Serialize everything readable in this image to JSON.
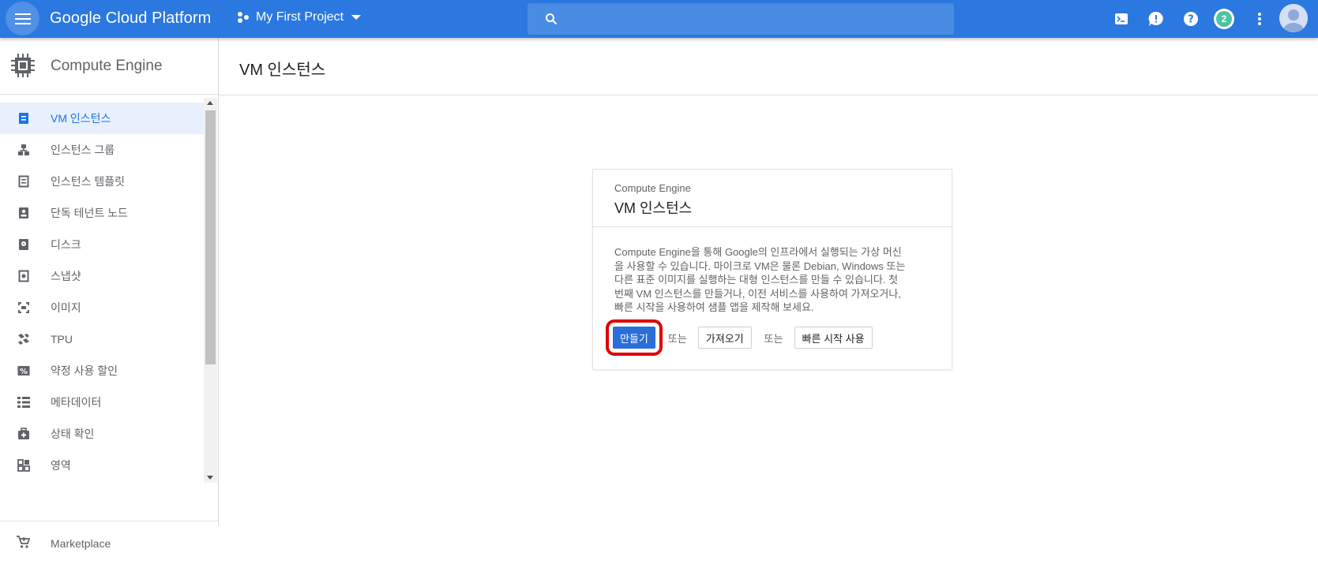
{
  "topbar": {
    "brand": "Google Cloud Platform",
    "project": "My First Project",
    "search_placeholder": "",
    "notification_count": "2",
    "icons": [
      "menu-icon",
      "project-icon",
      "search-icon",
      "cloud-shell-icon",
      "feedback-icon",
      "help-icon",
      "more-vert-icon",
      "account-icon"
    ],
    "color": "#2a78e0"
  },
  "sidebar": {
    "title": "Compute Engine",
    "items": [
      {
        "label": "VM 인스턴스",
        "icon": "vm-instance-icon",
        "active": true
      },
      {
        "label": "인스턴스 그룹",
        "icon": "instance-group-icon"
      },
      {
        "label": "인스턴스 템플릿",
        "icon": "instance-template-icon"
      },
      {
        "label": "단독 테넌트 노드",
        "icon": "sole-tenant-icon"
      },
      {
        "label": "디스크",
        "icon": "disk-icon"
      },
      {
        "label": "스냅샷",
        "icon": "snapshot-icon"
      },
      {
        "label": "이미지",
        "icon": "image-icon"
      },
      {
        "label": "TPU",
        "icon": "tpu-icon"
      },
      {
        "label": "약정 사용 할인",
        "icon": "discount-icon"
      },
      {
        "label": "메타데이터",
        "icon": "metadata-icon"
      },
      {
        "label": "상태 확인",
        "icon": "health-check-icon"
      },
      {
        "label": "영역",
        "icon": "zones-icon"
      }
    ],
    "marketplace": "Marketplace",
    "active_color": "#1a73e8"
  },
  "main": {
    "title": "VM 인스턴스"
  },
  "card": {
    "subtitle": "Compute Engine",
    "title": "VM 인스턴스",
    "body_lines": [
      "Compute Engine을 통해 Google의 인프라에서 실행되는 가상 머신",
      "을 사용할 수 있습니다. 마이크로 VM은 물론 Debian, Windows 또는",
      "다른 표준 이미지를 실행하는 대형 인스턴스를 만들 수 있습니다. 첫",
      "번째 VM 인스턴스를 만들거나, 이전 서비스를 사용하여 가져오거나,",
      "빠른 시작을 사용하여 샘플 앱을 제작해 보세요."
    ],
    "create_label": "만들기",
    "or_label": "또는",
    "import_label": "가져오기",
    "or_label_2": "또는",
    "quickstart_label": "빠른 시작 사용",
    "highlight_color": "#e00000"
  }
}
